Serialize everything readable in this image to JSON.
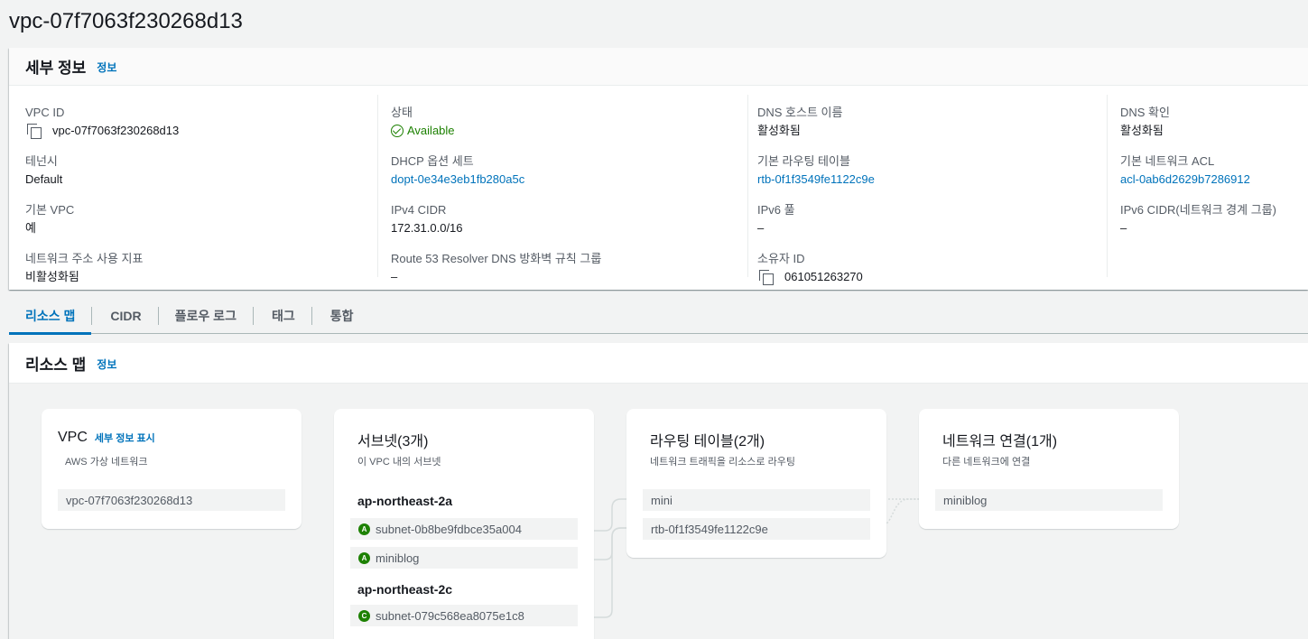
{
  "page": {
    "title": "vpc-07f7063f230268d13"
  },
  "details": {
    "title": "세부 정보",
    "info": "정보",
    "col1": [
      {
        "label": "VPC ID",
        "value": "vpc-07f7063f230268d13",
        "copy": true
      },
      {
        "label": "테넌시",
        "value": "Default"
      },
      {
        "label": "기본 VPC",
        "value": "예"
      },
      {
        "label": "네트워크 주소 사용 지표",
        "value": "비활성화됨"
      }
    ],
    "col2": [
      {
        "label": "상태",
        "value": "Available",
        "status": "ok"
      },
      {
        "label": "DHCP 옵션 세트",
        "value": "dopt-0e34e3eb1fb280a5c",
        "link": true
      },
      {
        "label": "IPv4 CIDR",
        "value": "172.31.0.0/16"
      },
      {
        "label": "Route 53 Resolver DNS 방화벽 규칙 그룹",
        "value": "–"
      }
    ],
    "col3": [
      {
        "label": "DNS 호스트 이름",
        "value": "활성화됨"
      },
      {
        "label": "기본 라우팅 테이블",
        "value": "rtb-0f1f3549fe1122c9e",
        "link": true
      },
      {
        "label": "IPv6 풀",
        "value": "–"
      },
      {
        "label": "소유자 ID",
        "value": "061051263270",
        "copy": true
      }
    ],
    "col4": [
      {
        "label": "DNS 확인",
        "value": "활성화됨"
      },
      {
        "label": "기본 네트워크 ACL",
        "value": "acl-0ab6d2629b7286912",
        "link": true
      },
      {
        "label": "IPv6 CIDR(네트워크 경계 그룹)",
        "value": "–"
      }
    ]
  },
  "tabs": [
    {
      "label": "리소스 맵",
      "active": true
    },
    {
      "label": "CIDR"
    },
    {
      "label": "플로우 로그"
    },
    {
      "label": "태그"
    },
    {
      "label": "통합"
    }
  ],
  "resource_map": {
    "title": "리소스 맵",
    "info": "정보",
    "vpc_card": {
      "title": "VPC",
      "link": "세부 정보 표시",
      "sub": "AWS 가상 네트워크",
      "item": "vpc-07f7063f230268d13"
    },
    "subnet_card": {
      "title": "서브넷(3개)",
      "sub": "이 VPC 내의 서브넷",
      "az1": "ap-northeast-2a",
      "az1_items": [
        {
          "badge": "A",
          "label": "subnet-0b8be9fdbce35a004"
        },
        {
          "badge": "A",
          "label": "miniblog"
        }
      ],
      "az2": "ap-northeast-2c",
      "az2_items": [
        {
          "badge": "C",
          "label": "subnet-079c568ea8075e1c8"
        }
      ]
    },
    "route_card": {
      "title": "라우팅 테이블(2개)",
      "sub": "네트워크 트래픽을 리소스로 라우팅",
      "items": [
        "mini",
        "rtb-0f1f3549fe1122c9e"
      ]
    },
    "network_card": {
      "title": "네트워크 연결(1개)",
      "sub": "다른 네트워크에 연결",
      "items": [
        "miniblog"
      ]
    }
  },
  "colors": {
    "link": "#0073bb",
    "success": "#1d8102",
    "text": "#16191f",
    "muted": "#545b64"
  }
}
